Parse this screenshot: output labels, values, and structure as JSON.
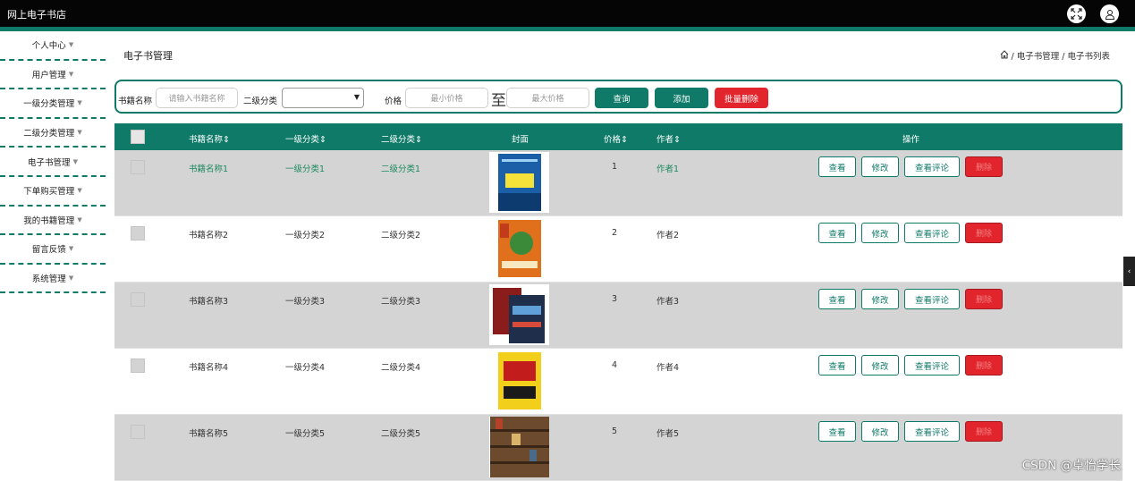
{
  "app": {
    "title": "网上电子书店"
  },
  "colors": {
    "accent": "#0e7a67",
    "danger": "#e2242c",
    "topbar": "#050505"
  },
  "icons": {
    "fullscreen": "fullscreen-icon",
    "user": "user-icon",
    "home": "home-icon"
  },
  "sidebar": {
    "items": [
      {
        "label": "个人中心"
      },
      {
        "label": "用户管理"
      },
      {
        "label": "一级分类管理"
      },
      {
        "label": "二级分类管理"
      },
      {
        "label": "电子书管理"
      },
      {
        "label": "下单购买管理"
      },
      {
        "label": "我的书籍管理"
      },
      {
        "label": "留言反馈"
      },
      {
        "label": "系统管理"
      }
    ]
  },
  "page": {
    "title": "电子书管理"
  },
  "breadcrumb": {
    "parts": [
      "/ 电子书管理",
      "/ 电子书列表"
    ]
  },
  "filter": {
    "name_label": "书籍名称",
    "name_placeholder": "请输入书籍名称",
    "category_label": "二级分类",
    "category_value": "",
    "price_label": "价格",
    "min_placeholder": "最小价格",
    "to_label": "至",
    "max_placeholder": "最大价格",
    "search_label": "查询",
    "add_label": "添加",
    "batch_delete_label": "批量删除"
  },
  "table": {
    "headers": {
      "name": "书籍名称⇕",
      "cat1": "一级分类⇕",
      "cat2": "二级分类⇕",
      "cover": "封面",
      "price": "价格⇕",
      "author": "作者⇕",
      "actions": "操作"
    },
    "action_labels": {
      "view": "查看",
      "edit": "修改",
      "reviews": "查看评论",
      "delete": "删除"
    },
    "rows": [
      {
        "name": "书籍名称1",
        "cat1": "一级分类1",
        "cat2": "二级分类1",
        "price": "1",
        "author": "作者1",
        "cover_text": "一本书",
        "cover_color": "#1a5fa8"
      },
      {
        "name": "书籍名称2",
        "cat1": "一级分类2",
        "cat2": "二级分类2",
        "price": "2",
        "author": "作者2",
        "cover_text": "中华上下五千年",
        "cover_color": "#e0701c"
      },
      {
        "name": "书籍名称3",
        "cat1": "一级分类3",
        "cat2": "二级分类3",
        "price": "3",
        "author": "作者3",
        "cover_text": "",
        "cover_color": "#2a2a3a"
      },
      {
        "name": "书籍名称4",
        "cat1": "一级分类4",
        "cat2": "二级分类4",
        "price": "4",
        "author": "作者4",
        "cover_text": "销售口才",
        "cover_color": "#f2cf1a"
      },
      {
        "name": "书籍名称5",
        "cat1": "一级分类5",
        "cat2": "二级分类5",
        "price": "5",
        "author": "作者5",
        "cover_text": "",
        "cover_color": "#6b4a2e"
      }
    ]
  },
  "watermark": "CSDN @卓怡学长"
}
